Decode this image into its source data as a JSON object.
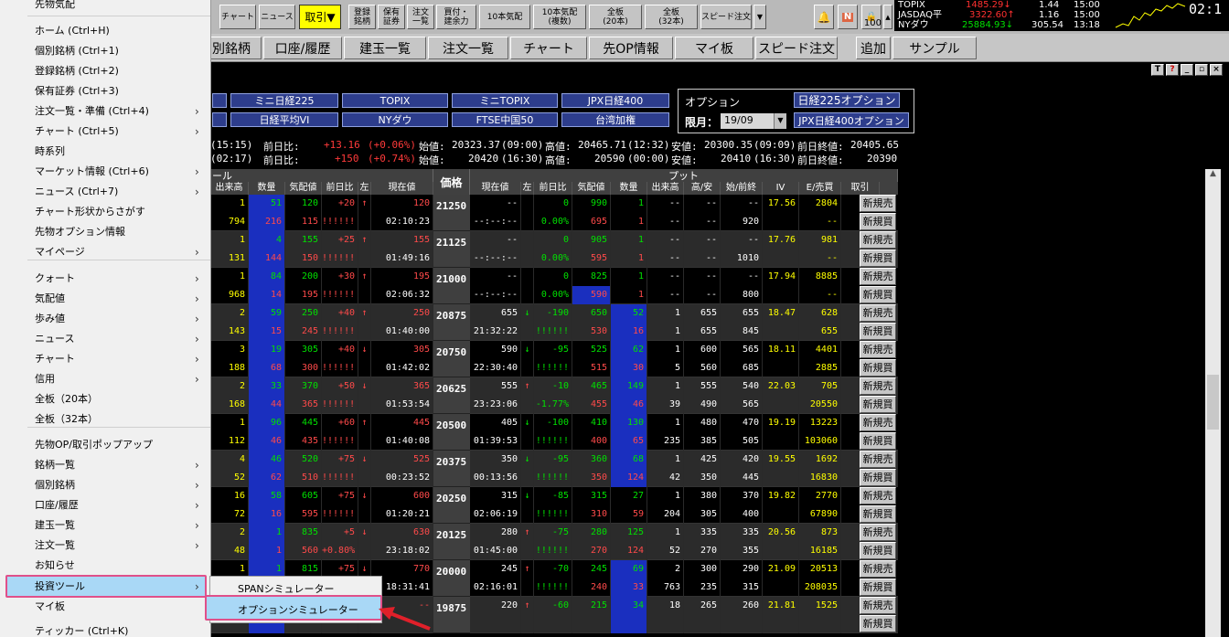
{
  "toolbar": {
    "buttons": [
      "チャート",
      "ニュース",
      "取引▼",
      "登録\n銘柄",
      "保有\n証券",
      "注文\n一覧",
      "買付・\n建余力",
      "10本気配",
      "10本気配\n(複数)",
      "全板\n(20本)",
      "全板\n(32本)",
      "スピード注文"
    ],
    "n_icon": "N",
    "count": "100"
  },
  "ticker": {
    "rows": [
      {
        "name": "TOPIX",
        "value": "1485.29↓",
        "chg": "1.44",
        "time": "15:00"
      },
      {
        "name": "JASDAQ平",
        "value": "3322.60↑",
        "chg": "1.16",
        "time": "15:00"
      },
      {
        "name": "NYダウ",
        "value": "25884.93↓",
        "chg": "305.54",
        "time": "13:18"
      }
    ],
    "clock": "02:1"
  },
  "nav": {
    "tabs": [
      "別銘柄",
      "口座/履歴",
      "建玉一覧",
      "注文一覧",
      "チャート",
      "先OP情報",
      "マイ板",
      "スピード注文",
      "追加",
      "サンプル"
    ]
  },
  "strip": {
    "btns": [
      "T",
      "?",
      "_",
      "▫",
      "×"
    ]
  },
  "indices": {
    "row1": [
      "ミニ日経225",
      "TOPIX",
      "ミニTOPIX",
      "JPX日経400"
    ],
    "row2": [
      "日経平均VI",
      "NYダウ",
      "FTSE中国50",
      "台湾加権"
    ]
  },
  "option_box": {
    "title": "オプション",
    "btn1": "日経225オプション",
    "month_label": "限月：",
    "month": "19/09",
    "btn2": "JPX日経400オプション"
  },
  "quotes": {
    "row1": {
      "time": "(15:15)",
      "chg_label": "前日比:",
      "chg": "+13.16",
      "pct": "(+0.06%)",
      "o_label": "始値:",
      "open": "20323.37",
      "o_time": "(09:00)",
      "h_label": "高値:",
      "high": "20465.71",
      "h_time": "(12:32)",
      "l_label": "安値:",
      "low": "20300.35",
      "l_time": "(09:09)",
      "p_label": "前日終値:",
      "prev": "20405.65"
    },
    "row2": {
      "time": "(02:17)",
      "chg_label": "前日比:",
      "chg": "+150",
      "pct": "(+0.74%)",
      "o_label": "始値:",
      "open": "20420",
      "o_time": "(16:30)",
      "h_label": "高値:",
      "high": "20590",
      "h_time": "(00:00)",
      "l_label": "安値:",
      "low": "20410",
      "l_time": "(16:30)",
      "p_label": "前日終値:",
      "prev": "20390"
    }
  },
  "board": {
    "call_title": "ール",
    "put_title": "プット",
    "price_header": "価格",
    "call_cols": [
      "出来高",
      "数量",
      "気配値",
      "前日比",
      "左",
      "現在値"
    ],
    "put_cols": [
      "現在値",
      "左",
      "前日比",
      "気配値",
      "数量",
      "出来高",
      "高/安",
      "始/前終",
      "IV",
      "E/売買",
      "取引"
    ],
    "sell_btn": "新規売",
    "buy_btn": "新規買",
    "rows": [
      {
        "strike": "21250",
        "c": [
          [
            "1",
            "51",
            "120",
            "+20",
            "↑",
            "120"
          ],
          [
            "794",
            "216",
            "115",
            "!!!!!!",
            "",
            "02:10:23"
          ]
        ],
        "p": [
          [
            "--",
            "",
            "0",
            "990",
            "1",
            "--",
            "--",
            "--",
            "17.56",
            "2804"
          ],
          [
            "--:--:--",
            "",
            "0.00%",
            "695",
            "1",
            "--",
            "--",
            "920",
            "",
            "--"
          ]
        ]
      },
      {
        "strike": "21125",
        "c": [
          [
            "1",
            "4",
            "155",
            "+25",
            "↑",
            "155"
          ],
          [
            "131",
            "144",
            "150",
            "!!!!!!",
            "",
            "01:49:16"
          ]
        ],
        "p": [
          [
            "--",
            "",
            "0",
            "905",
            "1",
            "--",
            "--",
            "--",
            "17.76",
            "981"
          ],
          [
            "--:--:--",
            "",
            "0.00%",
            "595",
            "1",
            "--",
            "--",
            "1010",
            "",
            "--"
          ]
        ]
      },
      {
        "strike": "21000",
        "c": [
          [
            "1",
            "84",
            "200",
            "+30",
            "↑",
            "195"
          ],
          [
            "968",
            "14",
            "195",
            "!!!!!!",
            "",
            "02:06:32"
          ]
        ],
        "p": [
          [
            "--",
            "",
            "0",
            "825",
            "1",
            "--",
            "--",
            "--",
            "17.94",
            "8885"
          ],
          [
            "--:--:--",
            "",
            "0.00%",
            "590",
            "1",
            "--",
            "--",
            "800",
            "",
            "--"
          ]
        ]
      },
      {
        "strike": "20875",
        "c": [
          [
            "2",
            "59",
            "250",
            "+40",
            "↑",
            "250"
          ],
          [
            "143",
            "15",
            "245",
            "!!!!!!",
            "",
            "01:40:00"
          ]
        ],
        "p": [
          [
            "655",
            "↓",
            "-190",
            "650",
            "52",
            "1",
            "655",
            "655",
            "18.47",
            "628"
          ],
          [
            "21:32:22",
            "",
            "!!!!!!",
            "530",
            "16",
            "1",
            "655",
            "845",
            "",
            "655"
          ]
        ]
      },
      {
        "strike": "20750",
        "c": [
          [
            "3",
            "19",
            "305",
            "+40",
            "↓",
            "305"
          ],
          [
            "188",
            "68",
            "300",
            "!!!!!!",
            "",
            "01:42:02"
          ]
        ],
        "p": [
          [
            "590",
            "↓",
            "-95",
            "525",
            "62",
            "1",
            "600",
            "565",
            "18.11",
            "4401"
          ],
          [
            "22:30:40",
            "",
            "!!!!!!",
            "515",
            "30",
            "5",
            "560",
            "685",
            "",
            "2885"
          ]
        ]
      },
      {
        "strike": "20625",
        "c": [
          [
            "2",
            "33",
            "370",
            "+50",
            "↓",
            "365"
          ],
          [
            "168",
            "44",
            "365",
            "!!!!!!",
            "",
            "01:53:54"
          ]
        ],
        "p": [
          [
            "555",
            "↑",
            "-10",
            "465",
            "149",
            "1",
            "555",
            "540",
            "22.03",
            "705"
          ],
          [
            "23:23:06",
            "",
            "-1.77%",
            "455",
            "46",
            "39",
            "490",
            "565",
            "",
            "20550"
          ]
        ]
      },
      {
        "strike": "20500",
        "c": [
          [
            "1",
            "96",
            "445",
            "+60",
            "↑",
            "445"
          ],
          [
            "112",
            "46",
            "435",
            "!!!!!!",
            "",
            "01:40:08"
          ]
        ],
        "p": [
          [
            "405",
            "↓",
            "-100",
            "410",
            "130",
            "1",
            "480",
            "470",
            "19.19",
            "13223"
          ],
          [
            "01:39:53",
            "",
            "!!!!!!",
            "400",
            "65",
            "235",
            "385",
            "505",
            "",
            "103060"
          ]
        ]
      },
      {
        "strike": "20375",
        "c": [
          [
            "4",
            "46",
            "520",
            "+75",
            "↓",
            "525"
          ],
          [
            "52",
            "62",
            "510",
            "!!!!!!",
            "",
            "00:23:52"
          ]
        ],
        "p": [
          [
            "350",
            "↓",
            "-95",
            "360",
            "68",
            "1",
            "425",
            "420",
            "19.55",
            "1692"
          ],
          [
            "00:13:56",
            "",
            "!!!!!!",
            "350",
            "124",
            "42",
            "350",
            "445",
            "",
            "16830"
          ]
        ]
      },
      {
        "strike": "20250",
        "c": [
          [
            "16",
            "58",
            "605",
            "+75",
            "↓",
            "600"
          ],
          [
            "72",
            "16",
            "595",
            "!!!!!!",
            "",
            "01:20:21"
          ]
        ],
        "p": [
          [
            "315",
            "↓",
            "-85",
            "315",
            "27",
            "1",
            "380",
            "370",
            "19.82",
            "2770"
          ],
          [
            "02:06:19",
            "",
            "!!!!!!",
            "310",
            "59",
            "204",
            "305",
            "400",
            "",
            "67890"
          ]
        ]
      },
      {
        "strike": "20125",
        "c": [
          [
            "2",
            "1",
            "835",
            "+5",
            "↓",
            "630"
          ],
          [
            "48",
            "1",
            "560",
            "+0.80%",
            "",
            "23:18:02"
          ]
        ],
        "p": [
          [
            "280",
            "↑",
            "-75",
            "280",
            "125",
            "1",
            "335",
            "335",
            "20.56",
            "873"
          ],
          [
            "01:45:00",
            "",
            "!!!!!!",
            "270",
            "124",
            "52",
            "270",
            "355",
            "",
            "16185"
          ]
        ]
      },
      {
        "strike": "20000",
        "c": [
          [
            "1",
            "1",
            "815",
            "+75",
            "↓",
            "770"
          ],
          [
            "",
            "",
            "",
            "",
            "",
            "18:31:41"
          ]
        ],
        "p": [
          [
            "245",
            "↑",
            "-70",
            "245",
            "69",
            "2",
            "300",
            "290",
            "21.09",
            "20513"
          ],
          [
            "02:16:01",
            "",
            "!!!!!!",
            "240",
            "33",
            "763",
            "235",
            "315",
            "",
            "208035"
          ]
        ]
      },
      {
        "strike": "19875",
        "c": [
          [
            "",
            "",
            "",
            "",
            "",
            "--"
          ],
          [
            "",
            "",
            "",
            "",
            "",
            ""
          ]
        ],
        "p": [
          [
            "220",
            "↑",
            "-60",
            "215",
            "34",
            "18",
            "265",
            "260",
            "21.81",
            "1525"
          ],
          [
            "",
            "",
            "",
            "",
            "",
            "",
            "",
            "",
            "",
            ""
          ]
        ]
      }
    ]
  },
  "menu": {
    "items": [
      {
        "label": "先物気配",
        "arrow": false
      },
      {
        "label": "ホーム (Ctrl+H)",
        "arrow": false
      },
      {
        "label": "個別銘柄 (Ctrl+1)",
        "arrow": false
      },
      {
        "label": "登録銘柄 (Ctrl+2)",
        "arrow": false
      },
      {
        "label": "保有証券 (Ctrl+3)",
        "arrow": false
      },
      {
        "label": "注文一覧・準備 (Ctrl+4)",
        "arrow": true
      },
      {
        "label": "チャート (Ctrl+5)",
        "arrow": true
      },
      {
        "label": "時系列",
        "arrow": false
      },
      {
        "label": "マーケット情報 (Ctrl+6)",
        "arrow": true
      },
      {
        "label": "ニュース (Ctrl+7)",
        "arrow": true
      },
      {
        "label": "チャート形状からさがす",
        "arrow": false
      },
      {
        "label": "先物オプション情報",
        "arrow": false
      },
      {
        "label": "マイページ",
        "arrow": true
      },
      {
        "label": "クォート",
        "arrow": true
      },
      {
        "label": "気配値",
        "arrow": true
      },
      {
        "label": "歩み値",
        "arrow": true
      },
      {
        "label": "ニュース",
        "arrow": true
      },
      {
        "label": "チャート",
        "arrow": true
      },
      {
        "label": "信用",
        "arrow": true
      },
      {
        "label": "全板（20本）",
        "arrow": false
      },
      {
        "label": "全板（32本）",
        "arrow": false
      },
      {
        "label": "先物OP/取引ポップアップ",
        "arrow": false
      },
      {
        "label": "銘柄一覧",
        "arrow": true
      },
      {
        "label": "個別銘柄",
        "arrow": true
      },
      {
        "label": "口座/履歴",
        "arrow": true
      },
      {
        "label": "建玉一覧",
        "arrow": true
      },
      {
        "label": "注文一覧",
        "arrow": true
      },
      {
        "label": "お知らせ",
        "arrow": false
      },
      {
        "label": "投資ツール",
        "arrow": true
      },
      {
        "label": "マイ板",
        "arrow": false
      },
      {
        "label": "ティッカー (Ctrl+K)",
        "arrow": false
      }
    ],
    "submenu": [
      "SPANシミュレーター",
      "オプションシミュレーター"
    ]
  },
  "colors": {
    "accent_pink": "#e0508a",
    "highlight": "#a9d8f6",
    "arrow_red": "#e0202a",
    "call_blue": "#1a2fbf",
    "put_red": "#ff4a4a"
  }
}
